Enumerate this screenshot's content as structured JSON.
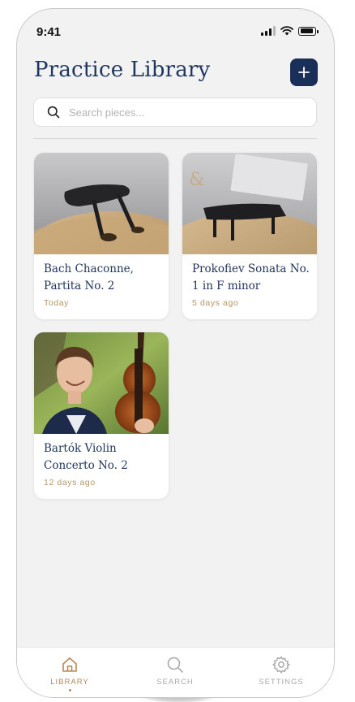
{
  "status_bar": {
    "time": "9:41",
    "icons": [
      "signal-icon",
      "wifi-icon",
      "battery-icon"
    ]
  },
  "header": {
    "title": "Practice Library",
    "add_button_icon": "plus-icon"
  },
  "search": {
    "placeholder": "Search pieces...",
    "value": "",
    "icon": "search-icon"
  },
  "pieces": [
    {
      "title": "Bach Chaconne, Partita No. 2",
      "date": "Today",
      "image": "violin-bridge-photo"
    },
    {
      "title": "Prokofiev Sonata No. 1 in F minor",
      "date": "5 days ago",
      "image": "violin-bridge-photo"
    },
    {
      "title": "Bartók Violin Concerto No. 2",
      "date": "12 days ago",
      "image": "violinist-portrait-photo"
    }
  ],
  "nav": {
    "items": [
      {
        "label": "LIBRARY",
        "icon": "home-icon",
        "active": true
      },
      {
        "label": "SEARCH",
        "icon": "search-icon",
        "active": false
      },
      {
        "label": "SETTINGS",
        "icon": "gear-icon",
        "active": false
      }
    ]
  },
  "colors": {
    "accent": "#1a2f58",
    "title": "#1f3660",
    "date": "#b89568",
    "nav_active": "#b8895a",
    "background": "#f2f2f3"
  }
}
